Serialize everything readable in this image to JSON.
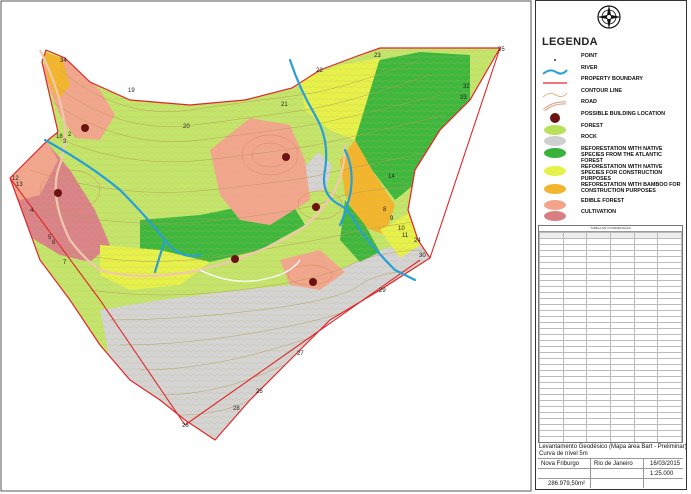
{
  "legend": {
    "title": "LEGENDA",
    "items": [
      {
        "label": "POINT",
        "icon": "point-icon"
      },
      {
        "label": "RIVER",
        "icon": "river-line-icon",
        "color": "#2a9fd6"
      },
      {
        "label": "PROPERTY BOUNDARY",
        "icon": "boundary-line-icon",
        "color": "#e0262a"
      },
      {
        "label": "CONTOUR LINE",
        "icon": "contour-line-icon",
        "color": "#e8a060"
      },
      {
        "label": "ROAD",
        "icon": "road-icon",
        "color": "#e8b49a"
      },
      {
        "label": "POSSIBLE BUILDING LOCATION",
        "icon": "building-location-icon",
        "color": "#6b1212"
      },
      {
        "label": "FOREST",
        "icon": "forest-swatch-icon",
        "color": "#b8e05a"
      },
      {
        "label": "ROCK",
        "icon": "rock-swatch-icon",
        "color": "#cfcfcf"
      },
      {
        "label": "REFORESTATION WITH NATIVE SPECIES FROM THE ATLANTIC FOREST",
        "icon": "atlantic-forest-swatch-icon",
        "color": "#38b23a"
      },
      {
        "label": "REFORESTATION WITH NATIVE SPECIES FOR CONSTRUCTION PURPOSES",
        "icon": "construction-species-swatch-icon",
        "color": "#e4f24a"
      },
      {
        "label": "REFORESTATION WITH BAMBOO FOR CONSTRUCTION PURPOSES",
        "icon": "bamboo-swatch-icon",
        "color": "#f3b52b"
      },
      {
        "label": "EDIBLE FOREST",
        "icon": "edible-forest-swatch-icon",
        "color": "#f4a48a"
      },
      {
        "label": "CULTIVATION",
        "icon": "cultivation-swatch-icon",
        "color": "#d97f83"
      }
    ]
  },
  "map": {
    "point_labels": [
      "2",
      "3",
      "4",
      "5",
      "6",
      "7",
      "8",
      "9",
      "10",
      "11",
      "12",
      "13",
      "14",
      "18",
      "19",
      "20",
      "21",
      "22",
      "23",
      "24",
      "25",
      "26",
      "27",
      "28",
      "29",
      "30",
      "32",
      "33",
      "34",
      "35"
    ]
  },
  "coordinate_table": {
    "title": "TABELA DE COORDENADAS",
    "rows": 38
  },
  "title_block": {
    "line1": "Levantamento Geodésico (Mapa área Bart - Preliminar)",
    "line2": "Curva de nível 5m",
    "municipality": "Nova Friburgo",
    "state": "Rio de Janeiro",
    "date": "16/03/2015",
    "scale": "1:25.000",
    "area": "286.979,50m²"
  }
}
